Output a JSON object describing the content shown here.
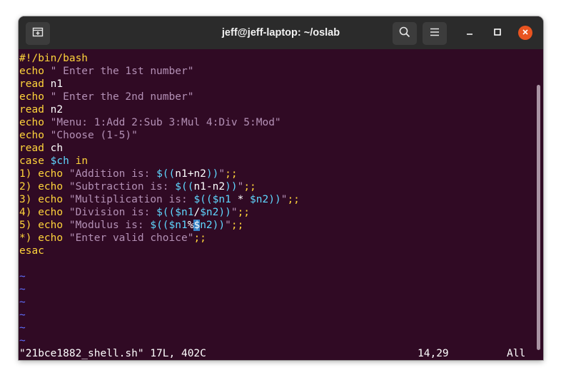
{
  "window": {
    "title": "jeff@jeff-laptop: ~/oslab",
    "close_color": "#e95420",
    "terminal_bg": "#300a24"
  },
  "titlebar": {
    "new_tab_icon": "new-tab-icon",
    "search_icon": "search-icon",
    "menu_icon": "hamburger-menu-icon",
    "minimize_icon": "minimize-icon",
    "maximize_icon": "maximize-icon",
    "close_icon": "close-icon"
  },
  "editor": {
    "lines": [
      {
        "text": "#!/bin/bash"
      },
      {
        "text": "echo \" Enter the 1st number\""
      },
      {
        "text": "read n1"
      },
      {
        "text": "echo \" Enter the 2nd number\""
      },
      {
        "text": "read n2"
      },
      {
        "text": "echo \"Menu: 1:Add 2:Sub 3:Mul 4:Div 5:Mod\""
      },
      {
        "text": "echo \"Choose (1-5)\""
      },
      {
        "text": "read ch"
      },
      {
        "text": "case $ch in"
      },
      {
        "text": "1) echo \"Addition is: $((n1+n2))\";;"
      },
      {
        "text": "2) echo \"Subtraction is: $((n1-n2))\";;"
      },
      {
        "text": "3) echo \"Multiplication is: $(($n1 * $n2))\";;"
      },
      {
        "text": "4) echo \"Division is: $(($n1/$n2))\";;"
      },
      {
        "text": "5) echo \"Modulus is: $(($n1%$n2))\";;"
      },
      {
        "text": "*) echo \"Enter valid choice\";;"
      },
      {
        "text": "esac"
      },
      {
        "text": ""
      }
    ],
    "tilde": "~",
    "tilde_count": 6
  },
  "statusline": {
    "file_info": "\"21bce1882_shell.sh\" 17L, 402C",
    "cursor_pos": "14,29",
    "scroll_pos": "All"
  },
  "colors": {
    "keyword": "#ffd43b",
    "string": "#b390b5",
    "variable": "#5fd7ff",
    "tilde": "#5f6fff",
    "cursor": "#3582c4"
  }
}
